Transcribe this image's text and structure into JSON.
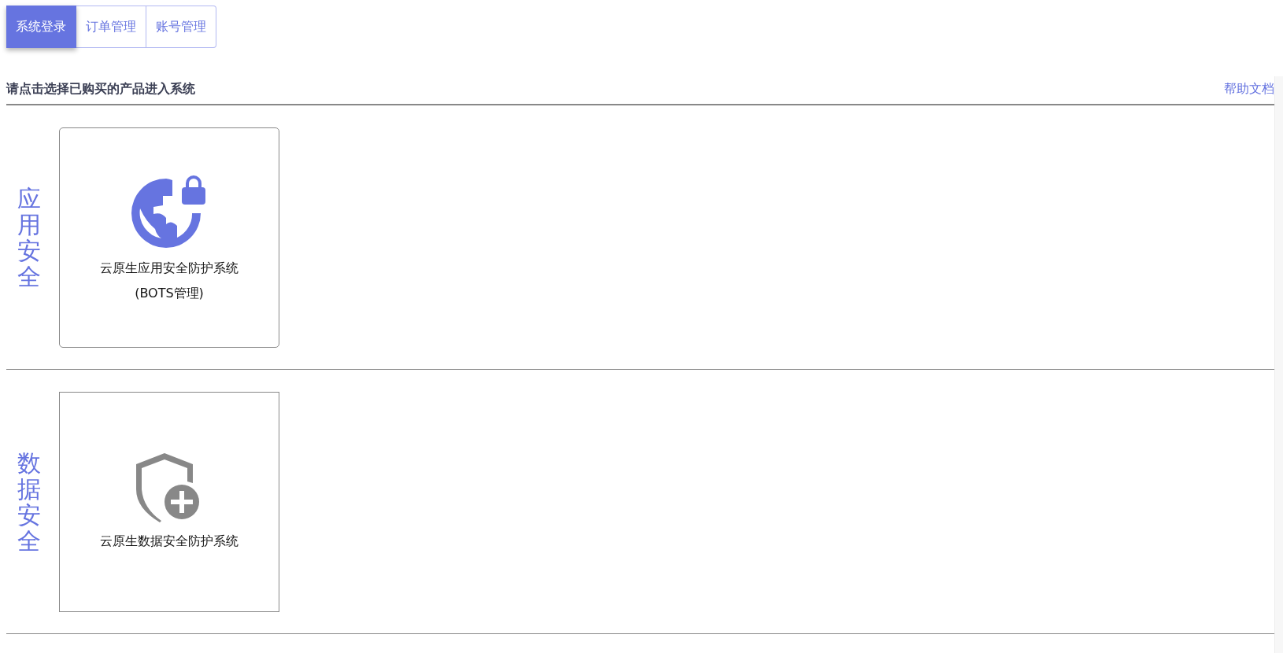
{
  "tabs": [
    {
      "label": "系统登录",
      "selected": true
    },
    {
      "label": "订单管理",
      "selected": false
    },
    {
      "label": "账号管理",
      "selected": false
    }
  ],
  "header": {
    "title": "请点击选择已购买的产品进入系统",
    "help_link": "帮助文档"
  },
  "sections": [
    {
      "category": "应用安全",
      "cards": [
        {
          "kind": "globe-lock",
          "enabled": true,
          "lines": [
            "云原生应用安全防护系统",
            "(BOTS管理)"
          ]
        }
      ]
    },
    {
      "category": "数据安全",
      "cards": [
        {
          "kind": "shield-plus",
          "enabled": false,
          "lines": [
            "云原生数据安全防护系统"
          ]
        }
      ]
    }
  ]
}
